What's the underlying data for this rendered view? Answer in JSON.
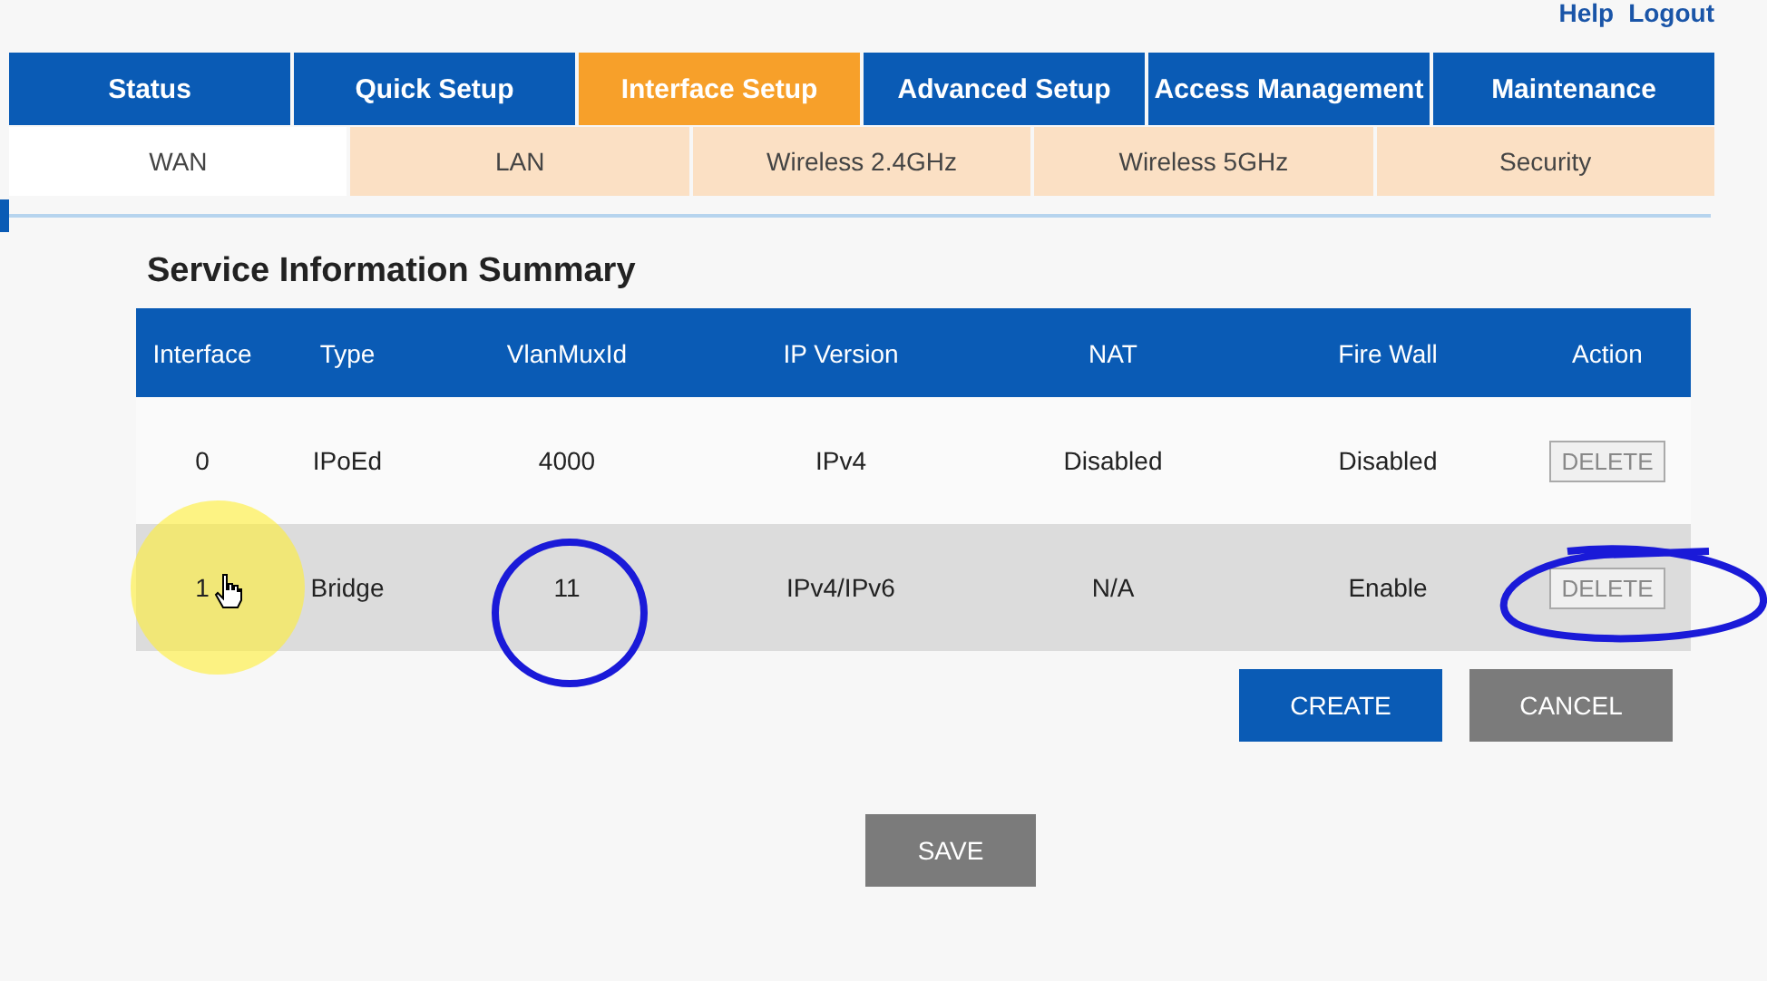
{
  "top_links": [
    "Help",
    "Logout"
  ],
  "tabs": [
    {
      "label": "Status",
      "selected": false
    },
    {
      "label": "Quick Setup",
      "selected": false
    },
    {
      "label": "Interface Setup",
      "selected": true
    },
    {
      "label": "Advanced Setup",
      "selected": false
    },
    {
      "label": "Access Management",
      "selected": false
    },
    {
      "label": "Maintenance",
      "selected": false
    }
  ],
  "subtabs": [
    {
      "label": "WAN",
      "selected": true
    },
    {
      "label": "LAN",
      "selected": false
    },
    {
      "label": "Wireless 2.4GHz",
      "selected": false
    },
    {
      "label": "Wireless 5GHz",
      "selected": false
    },
    {
      "label": "Security",
      "selected": false
    }
  ],
  "title": "Service Information Summary",
  "table": {
    "columns": [
      "Interface",
      "Type",
      "VlanMuxId",
      "IP Version",
      "NAT",
      "Fire Wall",
      "Action"
    ],
    "rows": [
      {
        "cells": [
          "0",
          "IPoEd",
          "4000",
          "IPv4",
          "Disabled",
          "Disabled"
        ],
        "action": "DELETE",
        "highlighted": false
      },
      {
        "cells": [
          "1",
          "Bridge",
          "11",
          "IPv4/IPv6",
          "N/A",
          "Enable"
        ],
        "action": "DELETE",
        "highlighted": true
      }
    ]
  },
  "buttons": [
    {
      "label": "CREATE",
      "kind": "primary"
    },
    {
      "label": "CANCEL",
      "kind": "secondary"
    }
  ],
  "save": "SAVE"
}
